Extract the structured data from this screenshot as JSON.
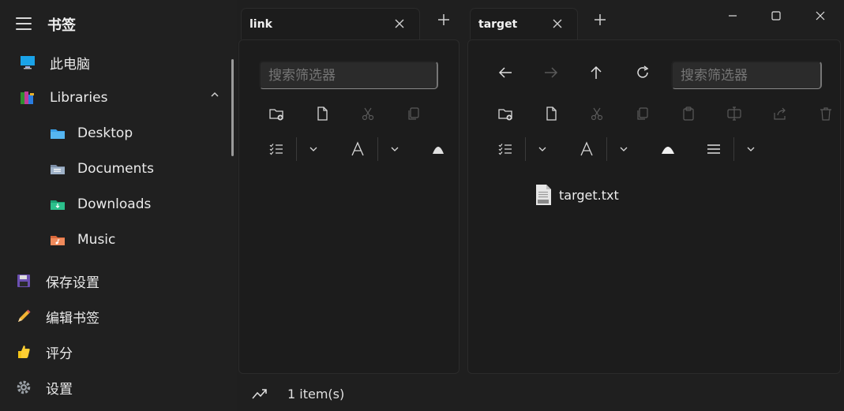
{
  "window": {
    "controls": [
      "minimize",
      "maximize",
      "close"
    ]
  },
  "sidebar": {
    "title": "书签",
    "items": [
      {
        "label": "此电脑",
        "icon": "monitor-icon"
      },
      {
        "label": "Libraries",
        "icon": "libraries-icon"
      },
      {
        "label": "Desktop",
        "icon": "desktop-folder-icon"
      },
      {
        "label": "Documents",
        "icon": "documents-folder-icon"
      },
      {
        "label": "Downloads",
        "icon": "downloads-folder-icon"
      },
      {
        "label": "Music",
        "icon": "music-folder-icon"
      },
      {
        "label": "保存设置",
        "icon": "floppy-disk-icon"
      },
      {
        "label": "编辑书签",
        "icon": "pencil-icon"
      },
      {
        "label": "评分",
        "icon": "thumbs-up-icon"
      },
      {
        "label": "设置",
        "icon": "gear-icon"
      }
    ]
  },
  "tabs": {
    "left": {
      "label": "link"
    },
    "right": {
      "label": "target"
    }
  },
  "left_pane": {
    "search_placeholder": "搜索筛选器"
  },
  "right_pane": {
    "search_placeholder": "搜索筛选器",
    "files": [
      {
        "name": "target.txt",
        "icon": "txt-file-icon"
      }
    ]
  },
  "status": {
    "text": "1 item(s)"
  },
  "colors": {
    "background": "#1f1f1f",
    "pane": "#1c1c1c",
    "text": "#e6e6e6",
    "disabled": "#5a5a5a"
  }
}
